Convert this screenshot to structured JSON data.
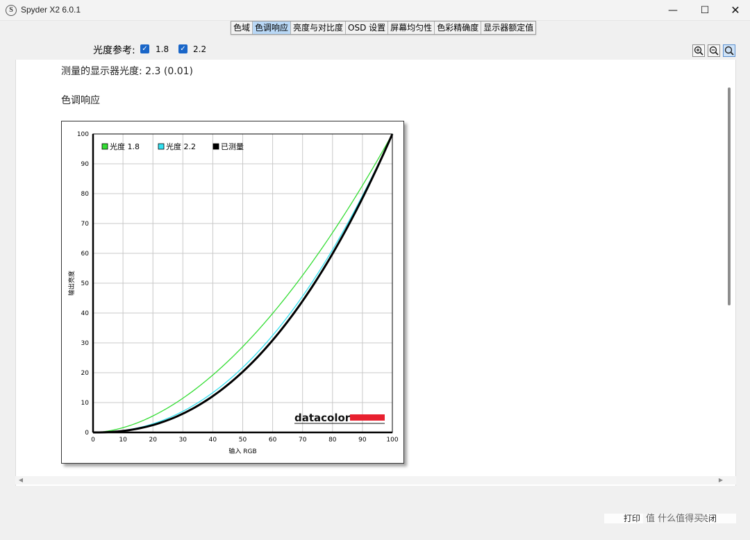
{
  "window": {
    "title": "Spyder X2 6.0.1",
    "app_icon": "S",
    "minimize": "—",
    "maximize": "☐",
    "close": "✕"
  },
  "tabs": [
    {
      "label": "色域",
      "active": false
    },
    {
      "label": "色调响应",
      "active": true
    },
    {
      "label": "亮度与对比度",
      "active": false
    },
    {
      "label": "OSD 设置",
      "active": false
    },
    {
      "label": "屏幕均匀性",
      "active": false
    },
    {
      "label": "色彩精确度",
      "active": false
    },
    {
      "label": "显示器额定值",
      "active": false
    }
  ],
  "reference": {
    "label": "光度参考:",
    "options": [
      {
        "label": "1.8",
        "checked": true
      },
      {
        "label": "2.2",
        "checked": true
      }
    ]
  },
  "zoom": {
    "zoom_in_icon": "zoom-in-icon",
    "zoom_out_icon": "zoom-out-icon",
    "zoom_fit_icon": "zoom-fit-icon"
  },
  "content": {
    "measured_gamma": "测量的显示器光度:  2.3 (0.01)",
    "section_title": "色调响应"
  },
  "chart_data": {
    "type": "line",
    "xlabel": "输入 RGB",
    "ylabel": "输出亮度",
    "xlim": [
      0,
      100
    ],
    "ylim": [
      0,
      100
    ],
    "xticks": [
      "0",
      "10",
      "20",
      "30",
      "40",
      "50",
      "60",
      "70",
      "80",
      "90",
      "100"
    ],
    "yticks": [
      "0",
      "10",
      "20",
      "30",
      "40",
      "50",
      "60",
      "70",
      "80",
      "90",
      "100"
    ],
    "grid": true,
    "legend_position": "top-left",
    "series": [
      {
        "name": "光度 1.8",
        "color": "#33dd33",
        "gamma": 1.8,
        "x": [
          0,
          10,
          20,
          30,
          40,
          50,
          60,
          70,
          80,
          90,
          100
        ],
        "y": [
          0,
          1.6,
          5.5,
          11.5,
          19.2,
          28.7,
          39.9,
          52.6,
          66.9,
          82.7,
          100
        ]
      },
      {
        "name": "光度 2.2",
        "color": "#33e0f0",
        "gamma": 2.2,
        "x": [
          0,
          10,
          20,
          30,
          40,
          50,
          60,
          70,
          80,
          90,
          100
        ],
        "y": [
          0,
          0.6,
          2.9,
          7.1,
          13.3,
          21.8,
          32.5,
          45.6,
          61.2,
          79.3,
          100
        ]
      },
      {
        "name": "已测量",
        "color": "#000000",
        "gamma": 2.3,
        "x": [
          0,
          10,
          20,
          30,
          40,
          50,
          60,
          70,
          80,
          90,
          100
        ],
        "y": [
          0,
          0.5,
          2.5,
          6.3,
          12.2,
          20.4,
          30.9,
          44.0,
          59.8,
          78.5,
          100
        ]
      }
    ],
    "brand": "datacolor",
    "brand_color": "#e8202f"
  },
  "buttons": {
    "print": "打印",
    "close": "关闭"
  },
  "watermark": "值 什么值得买"
}
